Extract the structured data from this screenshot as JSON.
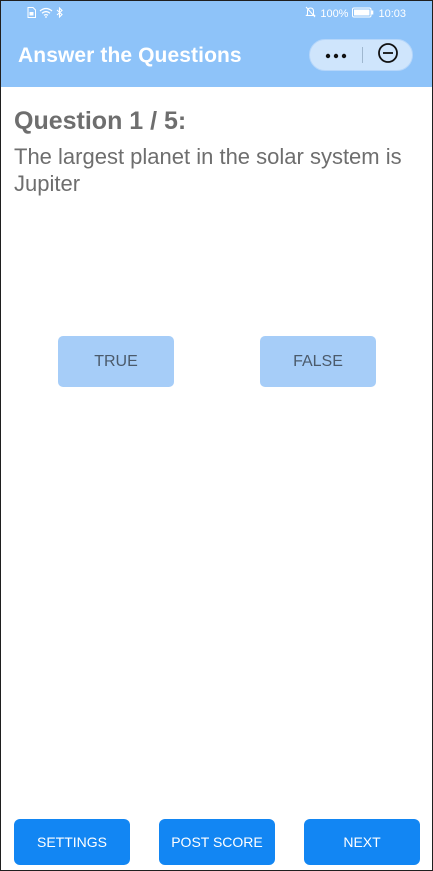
{
  "status_bar": {
    "battery_percent": "100%",
    "time": "10:03"
  },
  "header": {
    "title": "Answer the Questions"
  },
  "question": {
    "counter": "Question 1 / 5:",
    "text": "The largest planet in the solar system is Jupiter"
  },
  "answers": {
    "true_label": "TRUE",
    "false_label": "FALSE"
  },
  "footer": {
    "settings_label": "SETTINGS",
    "post_score_label": "POST SCORE",
    "next_label": "NEXT"
  },
  "colors": {
    "app_bar": "#8ec3f9",
    "answer_button": "#a6cdf8",
    "primary_button": "#1286f3",
    "question_text": "#6e6e6e"
  },
  "icons": [
    "sim-icon",
    "wifi-icon",
    "bluetooth-icon",
    "silent-bell-icon",
    "battery-icon",
    "more-icon",
    "close-circle-icon"
  ]
}
